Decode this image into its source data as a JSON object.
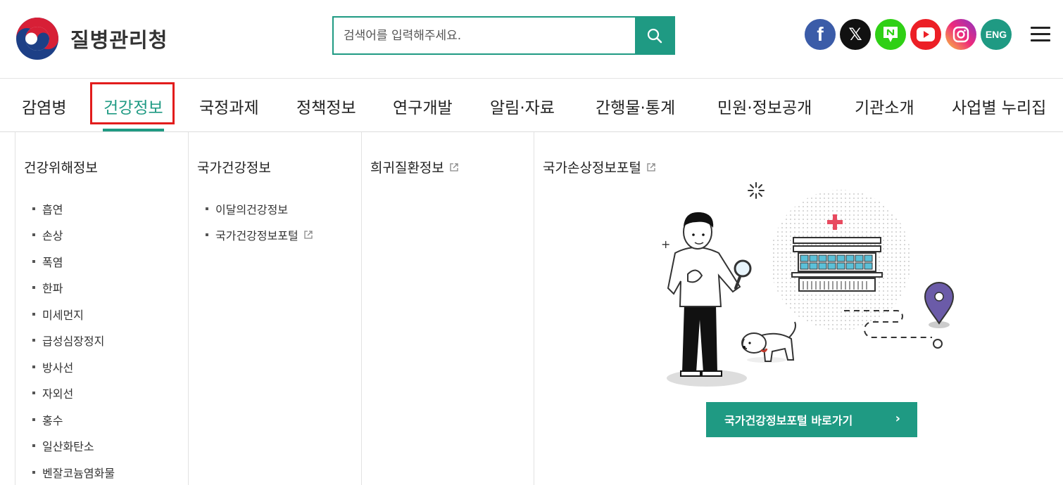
{
  "header": {
    "logo_text": "질병관리청",
    "search_placeholder": "검색어를 입력해주세요.",
    "social": {
      "facebook": "f",
      "x": "𝕏",
      "eng": "ENG"
    }
  },
  "gnb": {
    "items": [
      "감염병",
      "건강정보",
      "국정과제",
      "정책정보",
      "연구개발",
      "알림·자료",
      "간행물·통계",
      "민원·정보공개",
      "기관소개",
      "사업별 누리집"
    ],
    "active_index": 1
  },
  "panel": {
    "col1": {
      "title": "건강위해정보",
      "items": [
        "흡연",
        "손상",
        "폭염",
        "한파",
        "미세먼지",
        "급성심장정지",
        "방사선",
        "자외선",
        "홍수",
        "일산화탄소",
        "벤잘코늄염화물"
      ]
    },
    "col2": {
      "title": "국가건강정보",
      "items": [
        "이달의건강정보",
        "국가건강정보포털"
      ]
    },
    "col3": {
      "title": "희귀질환정보"
    },
    "col4": {
      "title": "국가손상정보포털",
      "cta_label": "국가건강정보포털 바로가기",
      "cta_arrow": "›"
    }
  },
  "colors": {
    "accent": "#1f9a83",
    "highlight_box": "#e21c1c"
  }
}
